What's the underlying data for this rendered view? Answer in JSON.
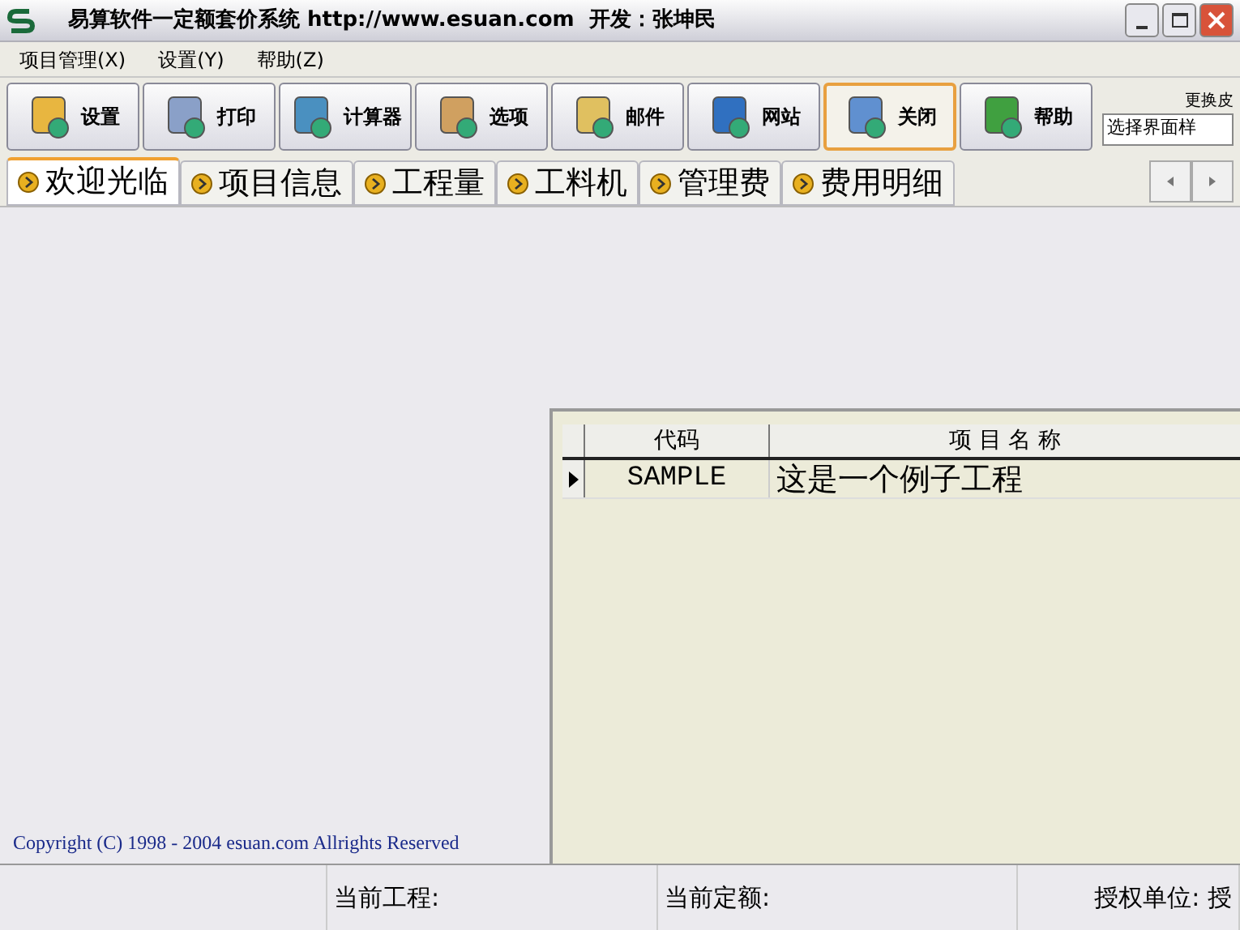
{
  "window": {
    "title": "易算软件一定额套价系统 http://www.esuan.com  开发：张坤民"
  },
  "menu": [
    {
      "label": "项目管理(X)"
    },
    {
      "label": "设置(Y)"
    },
    {
      "label": "帮助(Z)"
    }
  ],
  "toolbar": [
    {
      "label": "设置",
      "selected": false
    },
    {
      "label": "打印",
      "selected": false
    },
    {
      "label": "计算器",
      "selected": false
    },
    {
      "label": "选项",
      "selected": false
    },
    {
      "label": "邮件",
      "selected": false
    },
    {
      "label": "网站",
      "selected": false
    },
    {
      "label": "关闭",
      "selected": true
    },
    {
      "label": "帮助",
      "selected": false
    }
  ],
  "skin": {
    "label": "更换皮",
    "value": "选择界面样"
  },
  "tabs": [
    {
      "label": "欢迎光临",
      "selected": true
    },
    {
      "label": "项目信息",
      "selected": false
    },
    {
      "label": "工程量",
      "selected": false
    },
    {
      "label": "工料机",
      "selected": false
    },
    {
      "label": "管理费",
      "selected": false
    },
    {
      "label": "费用明细",
      "selected": false
    }
  ],
  "table": {
    "columns": [
      "代码",
      "项 目 名 称"
    ],
    "rows": [
      {
        "cells": [
          "SAMPLE",
          "这是一个例子工程"
        ],
        "selected": true
      }
    ]
  },
  "copyright": "Copyright (C) 1998 - 2004 esuan.com Allrights Reserved",
  "status_bar": [
    "当前工程:",
    "当前定额:",
    "授权单位: 授"
  ]
}
